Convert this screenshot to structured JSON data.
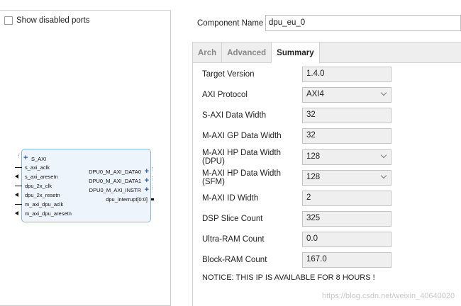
{
  "left": {
    "show_disabled_label": "Show disabled ports"
  },
  "block": {
    "left_ports": [
      "S_AXI",
      "s_axi_aclk",
      "s_axi_aresetn",
      "dpu_2x_clk",
      "dpu_2x_resetn",
      "m_axi_dpu_aclk",
      "m_axi_dpu_aresetn"
    ],
    "right_ports": [
      "DPU0_M_AXI_DATA0",
      "DPU0_M_AXI_DATA1",
      "DPU0_M_AXI_INSTR",
      "dpu_interrupt[0:0]"
    ]
  },
  "component": {
    "label": "Component Name",
    "value": "dpu_eu_0"
  },
  "tabs": [
    "Arch",
    "Advanced",
    "Summary"
  ],
  "active_tab": "Summary",
  "params": [
    {
      "label": "Target Version",
      "value": "1.4.0",
      "type": "text"
    },
    {
      "label": "AXI Protocol",
      "value": "AXI4",
      "type": "select"
    },
    {
      "label": "S-AXI Data Width",
      "value": "32",
      "type": "text"
    },
    {
      "label": "M-AXI GP Data Width",
      "value": "32",
      "type": "text"
    },
    {
      "label": "M-AXI HP Data Width (DPU)",
      "value": "128",
      "type": "select"
    },
    {
      "label": "M-AXI HP Data Width (SFM)",
      "value": "128",
      "type": "select"
    },
    {
      "label": "M-AXI ID Width",
      "value": "2",
      "type": "text"
    },
    {
      "label": "DSP Slice Count",
      "value": "325",
      "type": "text"
    },
    {
      "label": "Ultra-RAM Count",
      "value": "0.0",
      "type": "text"
    },
    {
      "label": "Block-RAM Count",
      "value": "167.0",
      "type": "text"
    }
  ],
  "notice": "NOTICE: THIS IP IS AVAILABLE FOR 8 HOURS !",
  "watermark": "https://blog.csdn.net/weixin_40640020"
}
